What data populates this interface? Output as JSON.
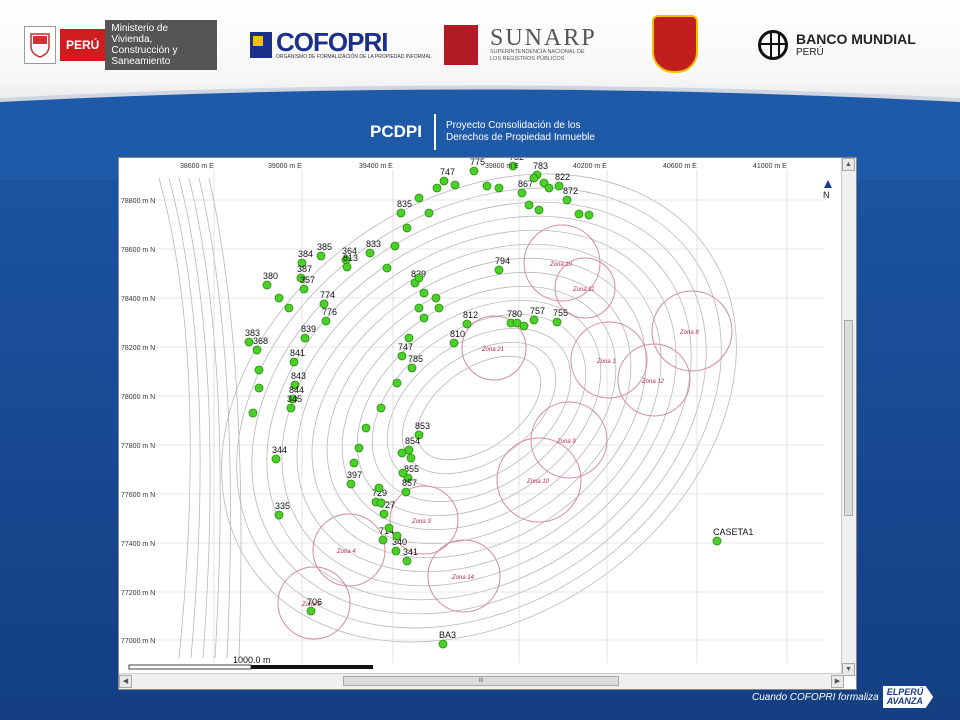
{
  "header": {
    "peru_label": "PERÚ",
    "ministry": "Ministerio de Vivienda, Construcción y Saneamiento",
    "cofopri": "COFOPRI",
    "cofopri_sub": "ORGANISMO DE FORMALIZACIÓN DE LA PROPIEDAD INFORMAL",
    "sunarp": "SUNARP",
    "sunarp_sub": "SUPERINTENDENCIA NACIONAL DE LOS REGISTROS PÚBLICOS",
    "bm_title": "BANCO MUNDIAL",
    "bm_sub": "PERÚ"
  },
  "project": {
    "title": "PCDPI",
    "subtitle": "Proyecto Consolidación de los Derechos de Propiedad Inmueble"
  },
  "map": {
    "x_ticks": [
      "38600 m E",
      "39000 m E",
      "39400 m E",
      "39800 m E",
      "40200 m E",
      "40600 m E",
      "41000 m E"
    ],
    "y_ticks": [
      "78800 m N",
      "78600 m N",
      "78400 m N",
      "78200 m N",
      "78000 m N",
      "77800 m N",
      "77600 m N",
      "77400 m N",
      "77200 m N",
      "77000 m N"
    ],
    "north_label": "N",
    "scale_label": "1000.0 m",
    "zones": [
      "Zona 10",
      "Zona 11",
      "Zona 8",
      "Zona 21",
      "Zona 12",
      "Zona 1",
      "Zona 3",
      "Zona 4",
      "Zona 14",
      "Zona 10",
      "Zona 5",
      "Zona 9"
    ],
    "zone_colors": {
      "circle": "#d48a9a",
      "text": "#c0294a"
    },
    "point_color": "#49d127",
    "points": [
      {
        "label": "782"
      },
      {
        "label": "783"
      },
      {
        "label": "822"
      },
      {
        "label": "867"
      },
      {
        "label": "872"
      },
      {
        "label": "835"
      },
      {
        "label": "747"
      },
      {
        "label": "775"
      },
      {
        "label": "364"
      },
      {
        "label": "813"
      },
      {
        "label": "833"
      },
      {
        "label": "385"
      },
      {
        "label": "384"
      },
      {
        "label": "387"
      },
      {
        "label": "380"
      },
      {
        "label": "357"
      },
      {
        "label": "774"
      },
      {
        "label": "776"
      },
      {
        "label": "383"
      },
      {
        "label": "839"
      },
      {
        "label": "368"
      },
      {
        "label": "841"
      },
      {
        "label": "843"
      },
      {
        "label": "844"
      },
      {
        "label": "345"
      },
      {
        "label": "839"
      },
      {
        "label": "794"
      },
      {
        "label": "812"
      },
      {
        "label": "780"
      },
      {
        "label": "757"
      },
      {
        "label": "755"
      },
      {
        "label": "810"
      },
      {
        "label": "747"
      },
      {
        "label": "785"
      },
      {
        "label": "853"
      },
      {
        "label": "854"
      },
      {
        "label": "855"
      },
      {
        "label": "857"
      },
      {
        "label": "344"
      },
      {
        "label": "397"
      },
      {
        "label": "729"
      },
      {
        "label": "335"
      },
      {
        "label": "727"
      },
      {
        "label": "714"
      },
      {
        "label": "340"
      },
      {
        "label": "341"
      },
      {
        "label": "706"
      },
      {
        "label": "BA3"
      },
      {
        "label": "CASETA1"
      }
    ]
  }
}
